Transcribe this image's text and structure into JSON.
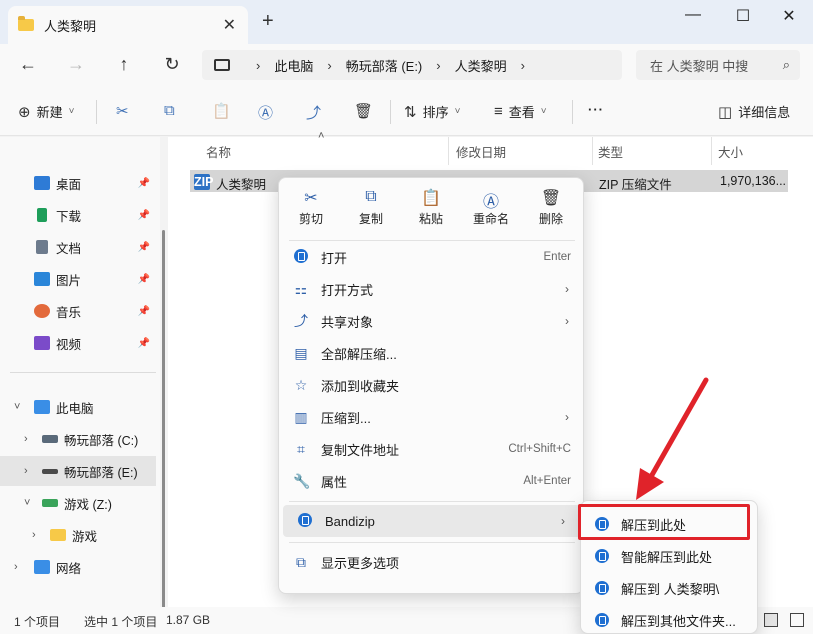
{
  "window": {
    "tab_title": "人类黎明",
    "tab_close": "✕",
    "tab_add": "+",
    "minimize": "—",
    "maximize": "☐",
    "close": "✕"
  },
  "nav": {
    "back": "←",
    "forward": "→",
    "up": "↑",
    "refresh": "↻"
  },
  "address": {
    "crumbs": [
      "此电脑",
      "畅玩部落 (E:)",
      "人类黎明"
    ],
    "sep": "›"
  },
  "search": {
    "placeholder": "在 人类黎明 中搜",
    "icon": "⌕"
  },
  "toolbar": {
    "new_label": "新建",
    "new_icon": "⊕",
    "cut_icon": "✂",
    "copy_icon": "⧉",
    "paste_icon": "📋",
    "rename_icon": "Ⓐ",
    "share_icon": "⤴",
    "delete_icon": "🗑",
    "sort_label": "排序",
    "sort_icon": "⇅",
    "view_label": "查看",
    "view_icon": "≡",
    "more_label": "···",
    "details_label": "详细信息",
    "details_icon": "◫",
    "dropdown": "˅"
  },
  "sidebar": {
    "quick": [
      {
        "label": "桌面",
        "color": "#2e7bd6"
      },
      {
        "label": "下载",
        "color": "#1e9e5a"
      },
      {
        "label": "文档",
        "color": "#6d7b8d"
      },
      {
        "label": "图片",
        "color": "#2b86d9"
      },
      {
        "label": "音乐",
        "color": "#e36a3c"
      },
      {
        "label": "视频",
        "color": "#7b4bc9"
      }
    ],
    "pin": "📌",
    "tree": [
      {
        "label": "此电脑",
        "chev": "˅"
      },
      {
        "label": "畅玩部落 (C:)",
        "chev": "›"
      },
      {
        "label": "畅玩部落 (E:)",
        "chev": "›"
      },
      {
        "label": "游戏 (Z:)",
        "chev": "˅"
      },
      {
        "label": "游戏",
        "chev": "›"
      },
      {
        "label": "网络",
        "chev": "›"
      }
    ]
  },
  "columns": {
    "name": "名称",
    "modified": "修改日期",
    "type": "类型",
    "size": "大小",
    "sort_arrow": "˄"
  },
  "file": {
    "name": "人类黎明",
    "type": "ZIP 压缩文件",
    "size": "1,970,136...",
    "icon_text": "ZIP"
  },
  "status": {
    "count": "1 个项目",
    "selected": "选中 1 个项目",
    "size": "1.87 GB"
  },
  "context_menu": {
    "quick_actions": [
      {
        "label": "剪切",
        "icon": "✂"
      },
      {
        "label": "复制",
        "icon": "⧉"
      },
      {
        "label": "粘贴",
        "icon": "📋"
      },
      {
        "label": "重命名",
        "icon": "Ⓐ"
      },
      {
        "label": "删除",
        "icon": "🗑"
      }
    ],
    "items": [
      {
        "label": "打开",
        "shortcut": "Enter",
        "icon": "●"
      },
      {
        "label": "打开方式",
        "shortcut": "",
        "icon": "⚏",
        "chev": "›"
      },
      {
        "label": "共享对象",
        "shortcut": "",
        "icon": "⤴",
        "chev": "›"
      },
      {
        "label": "全部解压缩...",
        "shortcut": "",
        "icon": "▤"
      },
      {
        "label": "添加到收藏夹",
        "shortcut": "",
        "icon": "☆"
      },
      {
        "label": "压缩到...",
        "shortcut": "",
        "icon": "▥",
        "chev": "›"
      },
      {
        "label": "复制文件地址",
        "shortcut": "Ctrl+Shift+C",
        "icon": "⌗"
      },
      {
        "label": "属性",
        "shortcut": "Alt+Enter",
        "icon": "🔧"
      }
    ],
    "bandizip": {
      "label": "Bandizip",
      "chev": "›"
    },
    "more": {
      "label": "显示更多选项",
      "icon": "⧉"
    }
  },
  "submenu": {
    "items": [
      "解压到此处",
      "智能解压到此处",
      "解压到 人类黎明\\",
      "解压到其他文件夹..."
    ]
  },
  "colors": {
    "highlight": "#e0232a",
    "accent": "#1f6fd1"
  }
}
